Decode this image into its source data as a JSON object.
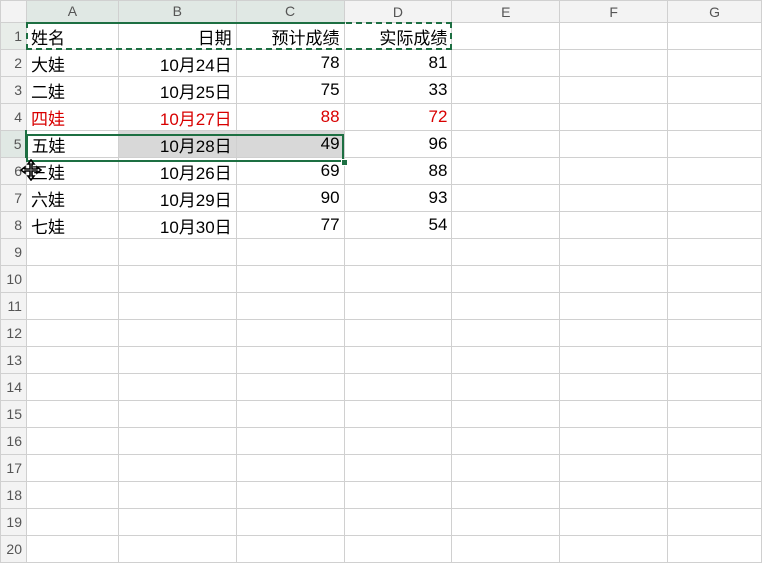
{
  "chart_data": {
    "type": "table",
    "columns": [
      "姓名",
      "日期",
      "预计成绩",
      "实际成绩"
    ],
    "rows": [
      [
        "大娃",
        "10月24日",
        78,
        81
      ],
      [
        "二娃",
        "10月25日",
        75,
        33
      ],
      [
        "四娃",
        "10月27日",
        88,
        72
      ],
      [
        "五娃",
        "10月28日",
        49,
        96
      ],
      [
        "三娃",
        "10月26日",
        69,
        88
      ],
      [
        "六娃",
        "10月29日",
        90,
        93
      ],
      [
        "七娃",
        "10月30日",
        77,
        54
      ]
    ]
  },
  "colheads": {
    "A": "A",
    "B": "B",
    "C": "C",
    "D": "D",
    "E": "E",
    "F": "F",
    "G": "G"
  },
  "rowheads": {
    "r1": "1",
    "r2": "2",
    "r3": "3",
    "r4": "4",
    "r5": "5",
    "r6": "6",
    "r7": "7",
    "r8": "8",
    "r9": "9",
    "r10": "10",
    "r11": "11",
    "r12": "12",
    "r13": "13",
    "r14": "14",
    "r15": "15",
    "r16": "16",
    "r17": "17",
    "r18": "18",
    "r19": "19",
    "r20": "20"
  },
  "cells": {
    "A1": "姓名",
    "B1": "日期",
    "C1": "预计成绩",
    "D1": "实际成绩",
    "A2": "大娃",
    "B2": "10月24日",
    "C2": "78",
    "D2": "81",
    "A3": "二娃",
    "B3": "10月25日",
    "C3": "75",
    "D3": "33",
    "A4": "四娃",
    "B4": "10月27日",
    "C4": "88",
    "D4": "72",
    "A5": "五娃",
    "B5": "10月28日",
    "C5": "49",
    "D5": "96",
    "A6": "三娃",
    "B6": "10月26日",
    "C6": "69",
    "D6": "88",
    "A7": "六娃",
    "B7": "10月29日",
    "C7": "90",
    "D7": "93",
    "A8": "七娃",
    "B8": "10月30日",
    "C8": "77",
    "D8": "54"
  },
  "selection": {
    "range": "A5:C5",
    "anchor": "A5"
  },
  "marquee": {
    "range": "A1:D1"
  },
  "colors": {
    "red_row": 4
  }
}
